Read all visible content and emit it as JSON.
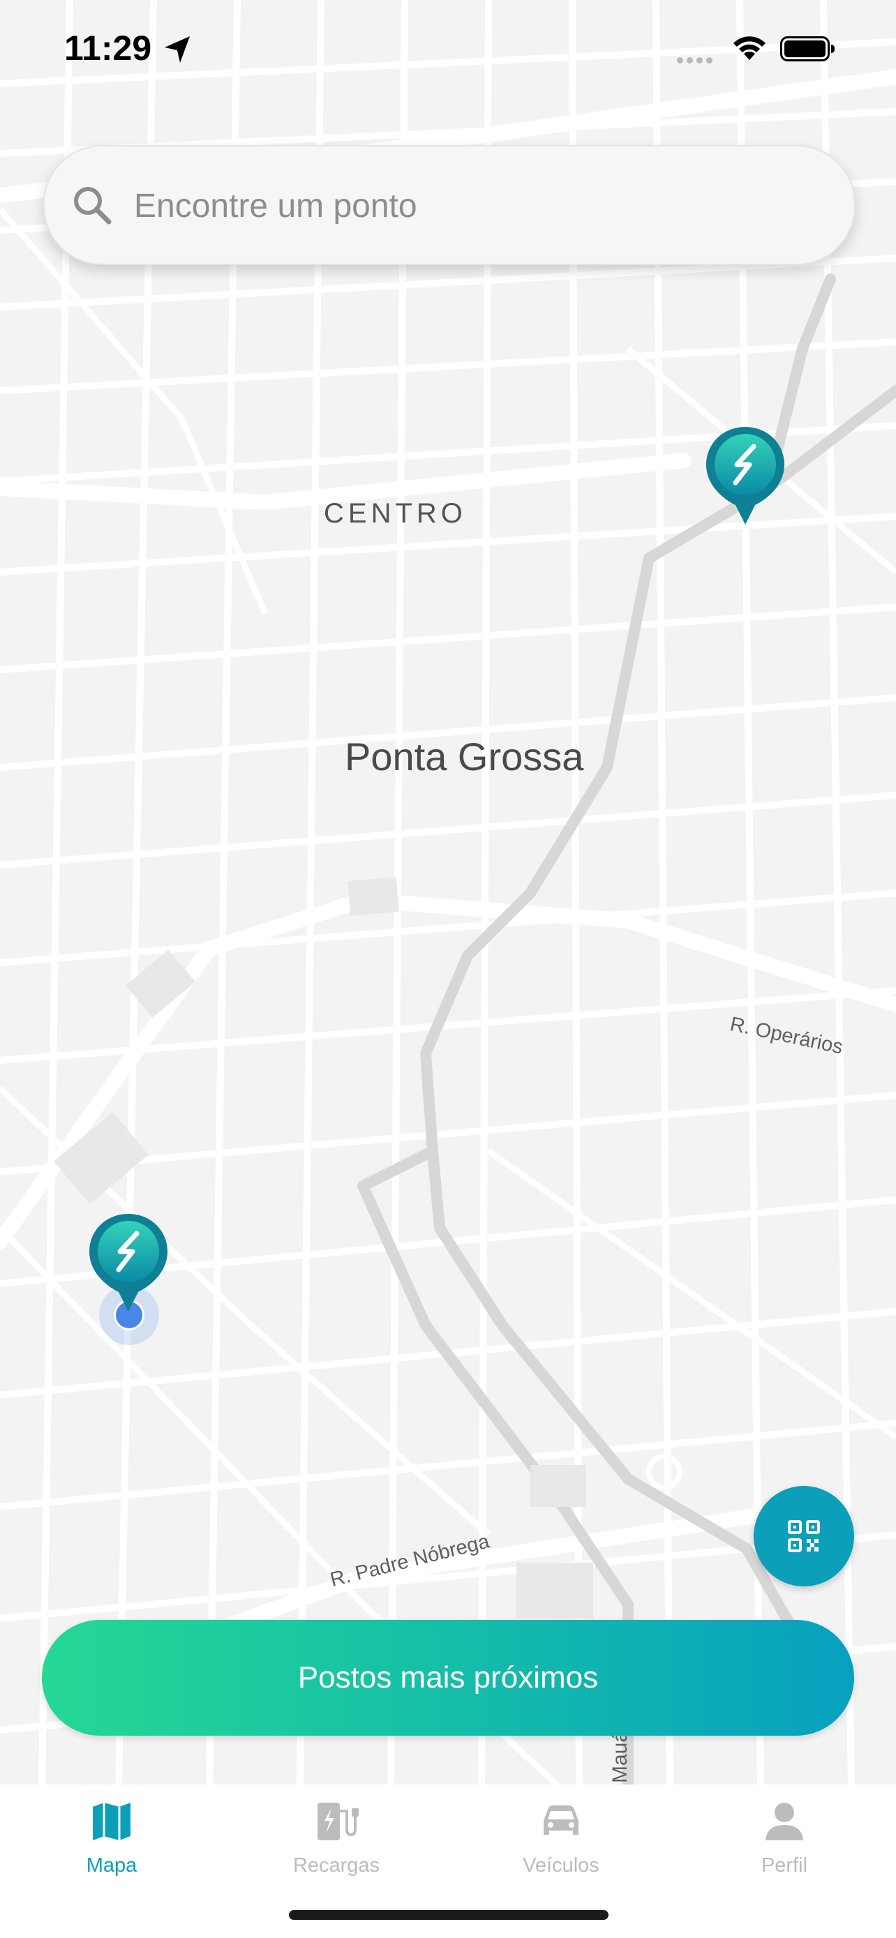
{
  "status_bar": {
    "time": "11:29"
  },
  "search": {
    "placeholder": "Encontre um ponto",
    "value": ""
  },
  "map": {
    "labels": {
      "district": "CENTRO",
      "city": "Ponta Grossa",
      "street_operarios": "R. Operários",
      "street_padre_nobrega": "R. Padre Nóbrega",
      "street_maua": "Mauá"
    },
    "markers": [
      {
        "type": "charging-station",
        "icon": "lightning-icon"
      },
      {
        "type": "charging-station",
        "icon": "lightning-icon"
      }
    ],
    "user_location": true
  },
  "actions": {
    "nearest_label": "Postos mais próximos",
    "qr_icon": "qr-code-icon"
  },
  "tabs": [
    {
      "label": "Mapa",
      "icon": "map-icon",
      "active": true
    },
    {
      "label": "Recargas",
      "icon": "charger-icon",
      "active": false
    },
    {
      "label": "Veículos",
      "icon": "car-icon",
      "active": false
    },
    {
      "label": "Perfil",
      "icon": "person-icon",
      "active": false
    }
  ],
  "colors": {
    "accent": "#0b9fb9",
    "gradient_start": "#25d894",
    "gradient_end": "#07a0bf",
    "marker_top": "#34d3b8",
    "marker_bottom": "#0a8aa5",
    "inactive": "#bcbcbc",
    "map_background": "#f3f3f3",
    "road": "#ffffff",
    "highway": "#d7d7d7"
  }
}
